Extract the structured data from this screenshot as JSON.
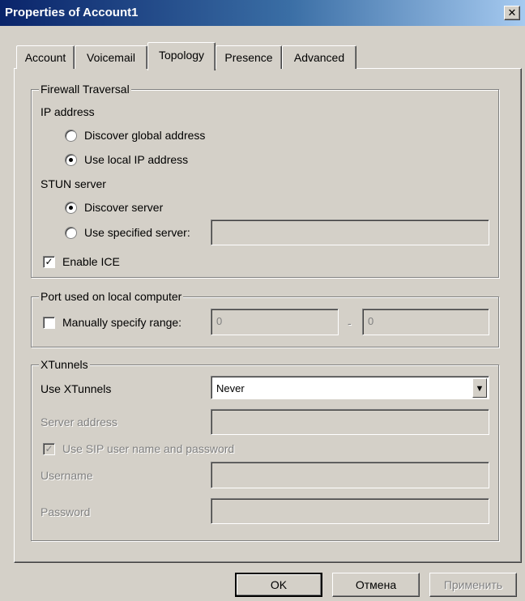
{
  "window": {
    "title": "Properties of Account1",
    "close_label": "✕"
  },
  "tabs": [
    "Account",
    "Voicemail",
    "Topology",
    "Presence",
    "Advanced"
  ],
  "firewall": {
    "label": "Firewall Traversal",
    "ip_label": "IP address",
    "ip_discover": "Discover global address",
    "ip_local": "Use local IP address",
    "stun_label": "STUN server",
    "stun_discover": "Discover server",
    "stun_specified": "Use specified server:",
    "stun_value": "",
    "ice": "Enable ICE"
  },
  "port": {
    "label": "Port used on local computer",
    "manual": "Manually specify range:",
    "from": "0",
    "dash": "-",
    "to": "0"
  },
  "xtunnels": {
    "label": "XTunnels",
    "use_label": "Use XTunnels",
    "use_value": "Never",
    "server_label": "Server address",
    "server_value": "",
    "sip_label": "Use SIP user name and password",
    "username_label": "Username",
    "username_value": "",
    "password_label": "Password",
    "password_value": ""
  },
  "buttons": {
    "ok": "OK",
    "cancel": "Отмена",
    "apply": "Применить"
  }
}
